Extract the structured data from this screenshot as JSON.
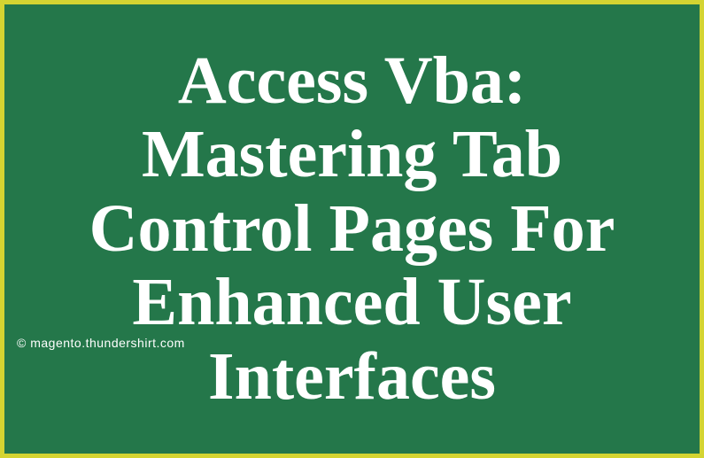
{
  "title": "Access Vba: Mastering Tab Control Pages For Enhanced User Interfaces",
  "copyright": "© magento.thundershirt.com"
}
